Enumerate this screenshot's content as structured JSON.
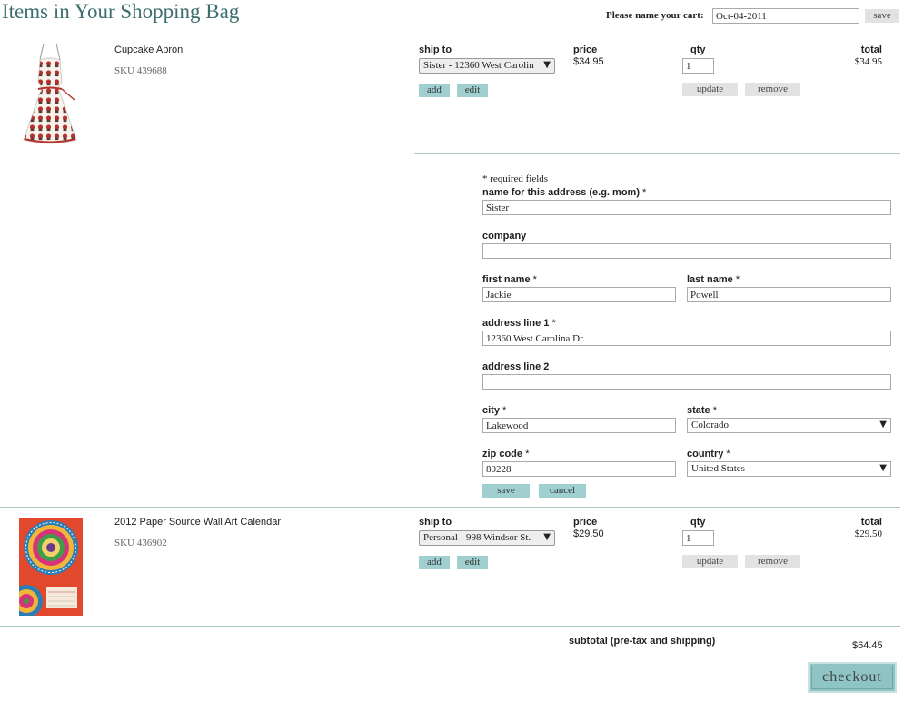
{
  "page": {
    "title": "Items in Your Shopping Bag"
  },
  "cart_name": {
    "label": "Please name your cart:",
    "value": "Oct-04-2011",
    "save_label": "save"
  },
  "columns": {
    "ship_to": "ship to",
    "price": "price",
    "qty": "qty",
    "total": "total"
  },
  "items": [
    {
      "name": "Cupcake Apron",
      "sku": "SKU 439688",
      "ship_to": "Sister - 12360 West Carolin",
      "price": "$34.95",
      "qty": "1",
      "total": "$34.95",
      "add_label": "add",
      "edit_label": "edit",
      "update_label": "update",
      "remove_label": "remove"
    },
    {
      "name": "2012 Paper Source Wall Art Calendar",
      "sku": "SKU 436902",
      "ship_to": "Personal - 998 Windsor St.",
      "price": "$29.50",
      "qty": "1",
      "total": "$29.50",
      "add_label": "add",
      "edit_label": "edit",
      "update_label": "update",
      "remove_label": "remove"
    }
  ],
  "address_form": {
    "required_note": "* required fields",
    "star": "*",
    "name_label": "name for this address (e.g. mom)",
    "name_value": "Sister",
    "company_label": "company",
    "company_value": "",
    "first_name_label": "first name",
    "first_name_value": "Jackie",
    "last_name_label": "last name",
    "last_name_value": "Powell",
    "address1_label": "address line 1",
    "address1_value": "12360 West Carolina Dr.",
    "address2_label": "address line 2",
    "address2_value": "",
    "city_label": "city",
    "city_value": "Lakewood",
    "state_label": "state",
    "state_value": "Colorado",
    "zip_label": "zip code",
    "zip_value": "80228",
    "country_label": "country",
    "country_value": "United States",
    "save_label": "save",
    "cancel_label": "cancel"
  },
  "summary": {
    "subtotal_label": "subtotal (pre-tax and shipping)",
    "subtotal_value": "$64.45",
    "checkout_label": "checkout"
  },
  "colors": {
    "accent": "#9fcfcf",
    "rule": "#a7c9c4",
    "title": "#3e6e6e"
  }
}
